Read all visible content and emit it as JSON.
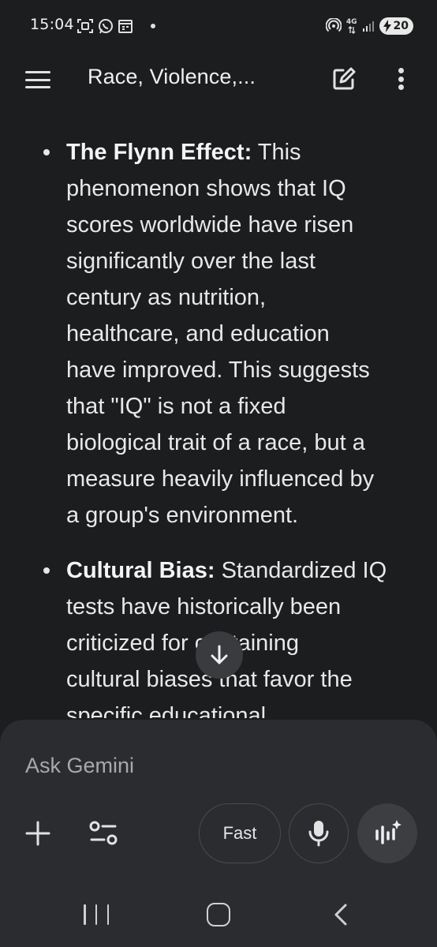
{
  "status_bar": {
    "time": "15:04",
    "left_icons": [
      "screenshot-icon",
      "whatsapp-icon",
      "calendar-icon",
      "dot-icon"
    ],
    "network_label": "4G",
    "battery_level": "20"
  },
  "app_bar": {
    "title": "Race, Violence,..."
  },
  "content": {
    "items": [
      {
        "heading": "The Flynn Effect:",
        "lines": [
          " This",
          "phenomenon shows that IQ",
          "scores worldwide have risen",
          "significantly over the last",
          "century as nutrition,",
          "healthcare, and education",
          "have improved. This suggests",
          "that \"IQ\" is not a fixed",
          "biological trait of a race, but a",
          "measure heavily influenced by",
          "a group's environment."
        ]
      },
      {
        "heading": "Cultural Bias:",
        "lines": [
          " Standardized IQ",
          "tests have historically been",
          "criticized for containing",
          "cultural biases that favor the",
          "specific educational"
        ]
      }
    ]
  },
  "input_panel": {
    "placeholder": "Ask Gemini",
    "mode_label": "Fast"
  },
  "colors": {
    "background": "#1c1d1f",
    "panel": "#2b2c2f",
    "text": "#e8e8e8"
  }
}
